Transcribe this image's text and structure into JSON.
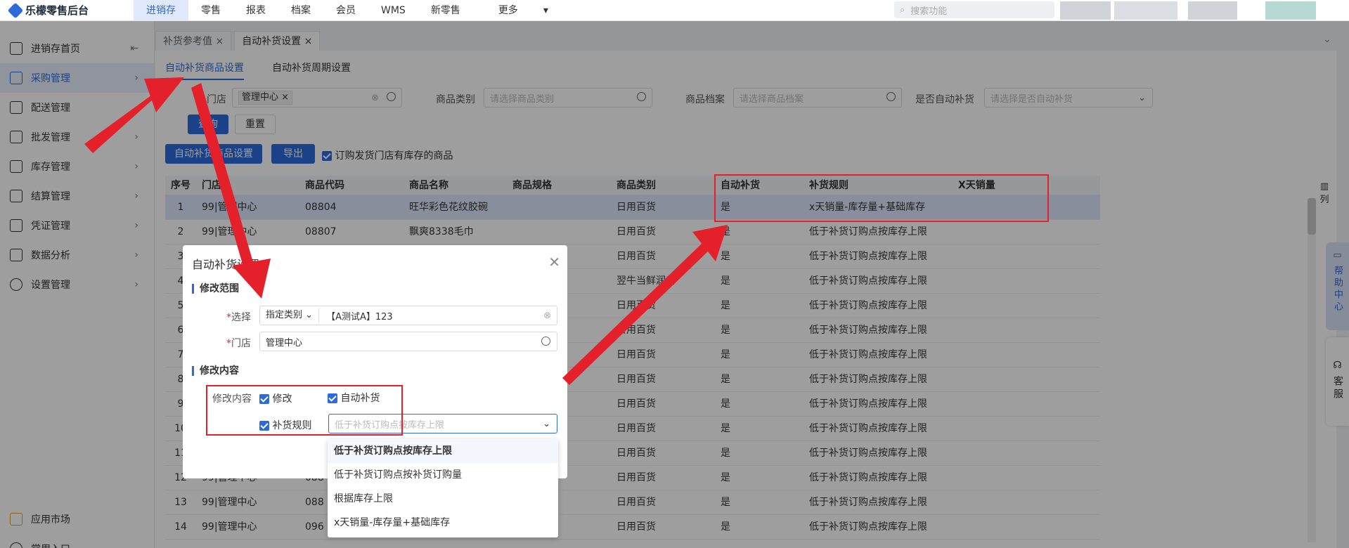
{
  "app": {
    "title": "乐檬零售后台"
  },
  "topnav": [
    "进销存",
    "零售",
    "报表",
    "档案",
    "会员",
    "WMS",
    "新零售",
    "更多"
  ],
  "search": {
    "placeholder": "搜索功能"
  },
  "sidebar": {
    "items": [
      {
        "label": "进销存首页",
        "icon": "home-icon"
      },
      {
        "label": "采购管理",
        "icon": "cart-icon"
      },
      {
        "label": "配送管理",
        "icon": "truck-icon"
      },
      {
        "label": "批发管理",
        "icon": "wholesale-icon"
      },
      {
        "label": "库存管理",
        "icon": "warehouse-icon"
      },
      {
        "label": "结算管理",
        "icon": "money-icon"
      },
      {
        "label": "凭证管理",
        "icon": "document-icon"
      },
      {
        "label": "数据分析",
        "icon": "chart-icon"
      },
      {
        "label": "设置管理",
        "icon": "gear-icon"
      }
    ],
    "bottom": [
      {
        "label": "应用市场",
        "icon": "apps-icon"
      },
      {
        "label": "常用入口",
        "icon": "heart-icon"
      }
    ]
  },
  "tabs": [
    {
      "label": "补货参考值"
    },
    {
      "label": "自动补货设置"
    }
  ],
  "subtabs": [
    "自动补货商品设置",
    "自动补货周期设置"
  ],
  "filters": {
    "store_label": "门店",
    "store_tag": "管理中心",
    "category_label": "商品类别",
    "category_placeholder": "请选择商品类别",
    "archive_label": "商品档案",
    "archive_placeholder": "请选择商品档案",
    "auto_label": "是否自动补货",
    "auto_placeholder": "请选择是否自动补货"
  },
  "buttons": {
    "query": "查询",
    "reset": "重置",
    "auto_set": "自动补货商品设置",
    "export": "导出",
    "checkbox_label": "订购发货门店有库存的商品"
  },
  "table": {
    "headers": [
      "序号",
      "门店",
      "商品代码",
      "商品名称",
      "商品规格",
      "商品类别",
      "自动补货",
      "补货规则",
      "X天销量"
    ],
    "rows": [
      [
        "1",
        "99|管理中心",
        "08804",
        "旺华彩色花纹胶碗",
        "",
        "日用百货",
        "是",
        "x天销量-库存量+基础库存",
        ""
      ],
      [
        "2",
        "99|管理中心",
        "08807",
        "飘爽8338毛巾",
        "",
        "日用百货",
        "是",
        "低于补货订购点按库存上限",
        ""
      ],
      [
        "3",
        "",
        "",
        "",
        "",
        "日用百货",
        "是",
        "低于补货订购点按库存上限",
        ""
      ],
      [
        "4",
        "",
        "",
        "",
        "",
        "翌牛当鲜润店",
        "是",
        "低于补货订购点按库存上限",
        ""
      ],
      [
        "5",
        "",
        "",
        "",
        "",
        "日用百货",
        "是",
        "低于补货订购点按库存上限",
        ""
      ],
      [
        "6",
        "",
        "",
        "",
        "",
        "日用百货",
        "是",
        "低于补货订购点按库存上限",
        ""
      ],
      [
        "7",
        "",
        "",
        "",
        "",
        "日用百货",
        "是",
        "低于补货订购点按库存上限",
        ""
      ],
      [
        "8",
        "",
        "",
        "",
        "",
        "日用百货",
        "是",
        "低于补货订购点按库存上限",
        ""
      ],
      [
        "9",
        "",
        "",
        "",
        "",
        "日用百货",
        "是",
        "低于补货订购点按库存上限",
        ""
      ],
      [
        "10",
        "",
        "",
        "",
        "",
        "日用百货",
        "是",
        "低于补货订购点按库存上限",
        ""
      ],
      [
        "11",
        "",
        "",
        "",
        "",
        "日用百货",
        "是",
        "低于补货订购点按库存上限",
        ""
      ],
      [
        "12",
        "99|管理中心",
        "088",
        "",
        "",
        "日用百货",
        "是",
        "低于补货订购点按库存上限",
        ""
      ],
      [
        "13",
        "99|管理中心",
        "088",
        "",
        "",
        "日用百货",
        "是",
        "低于补货订购点按库存上限",
        ""
      ],
      [
        "14",
        "99|管理中心",
        "096",
        "",
        "",
        "日用百货",
        "是",
        "低于补货订购点按库存上限",
        ""
      ]
    ],
    "column_button": "列"
  },
  "help": {
    "label": "帮助中心",
    "service": "客服"
  },
  "modal": {
    "title": "自动补货设置",
    "section_scope": "修改范围",
    "select_label": "选择",
    "select_type": "指定类别",
    "select_value": "【A测试A】123",
    "store_label": "门店",
    "store_value": "管理中心",
    "section_content": "修改内容",
    "content_label": "修改内容",
    "chk_modify": "修改",
    "chk_auto": "自动补货",
    "chk_rule": "补货规则",
    "rule_placeholder": "低于补货订购点按库存上限"
  },
  "dropdown": [
    "低于补货订购点按库存上限",
    "低于补货订购点按补货订购量",
    "根据库存上限",
    "x天销量-库存量+基础库存"
  ],
  "colors": {
    "accent": "#2d6bdc",
    "annotation": "#e4202a"
  }
}
